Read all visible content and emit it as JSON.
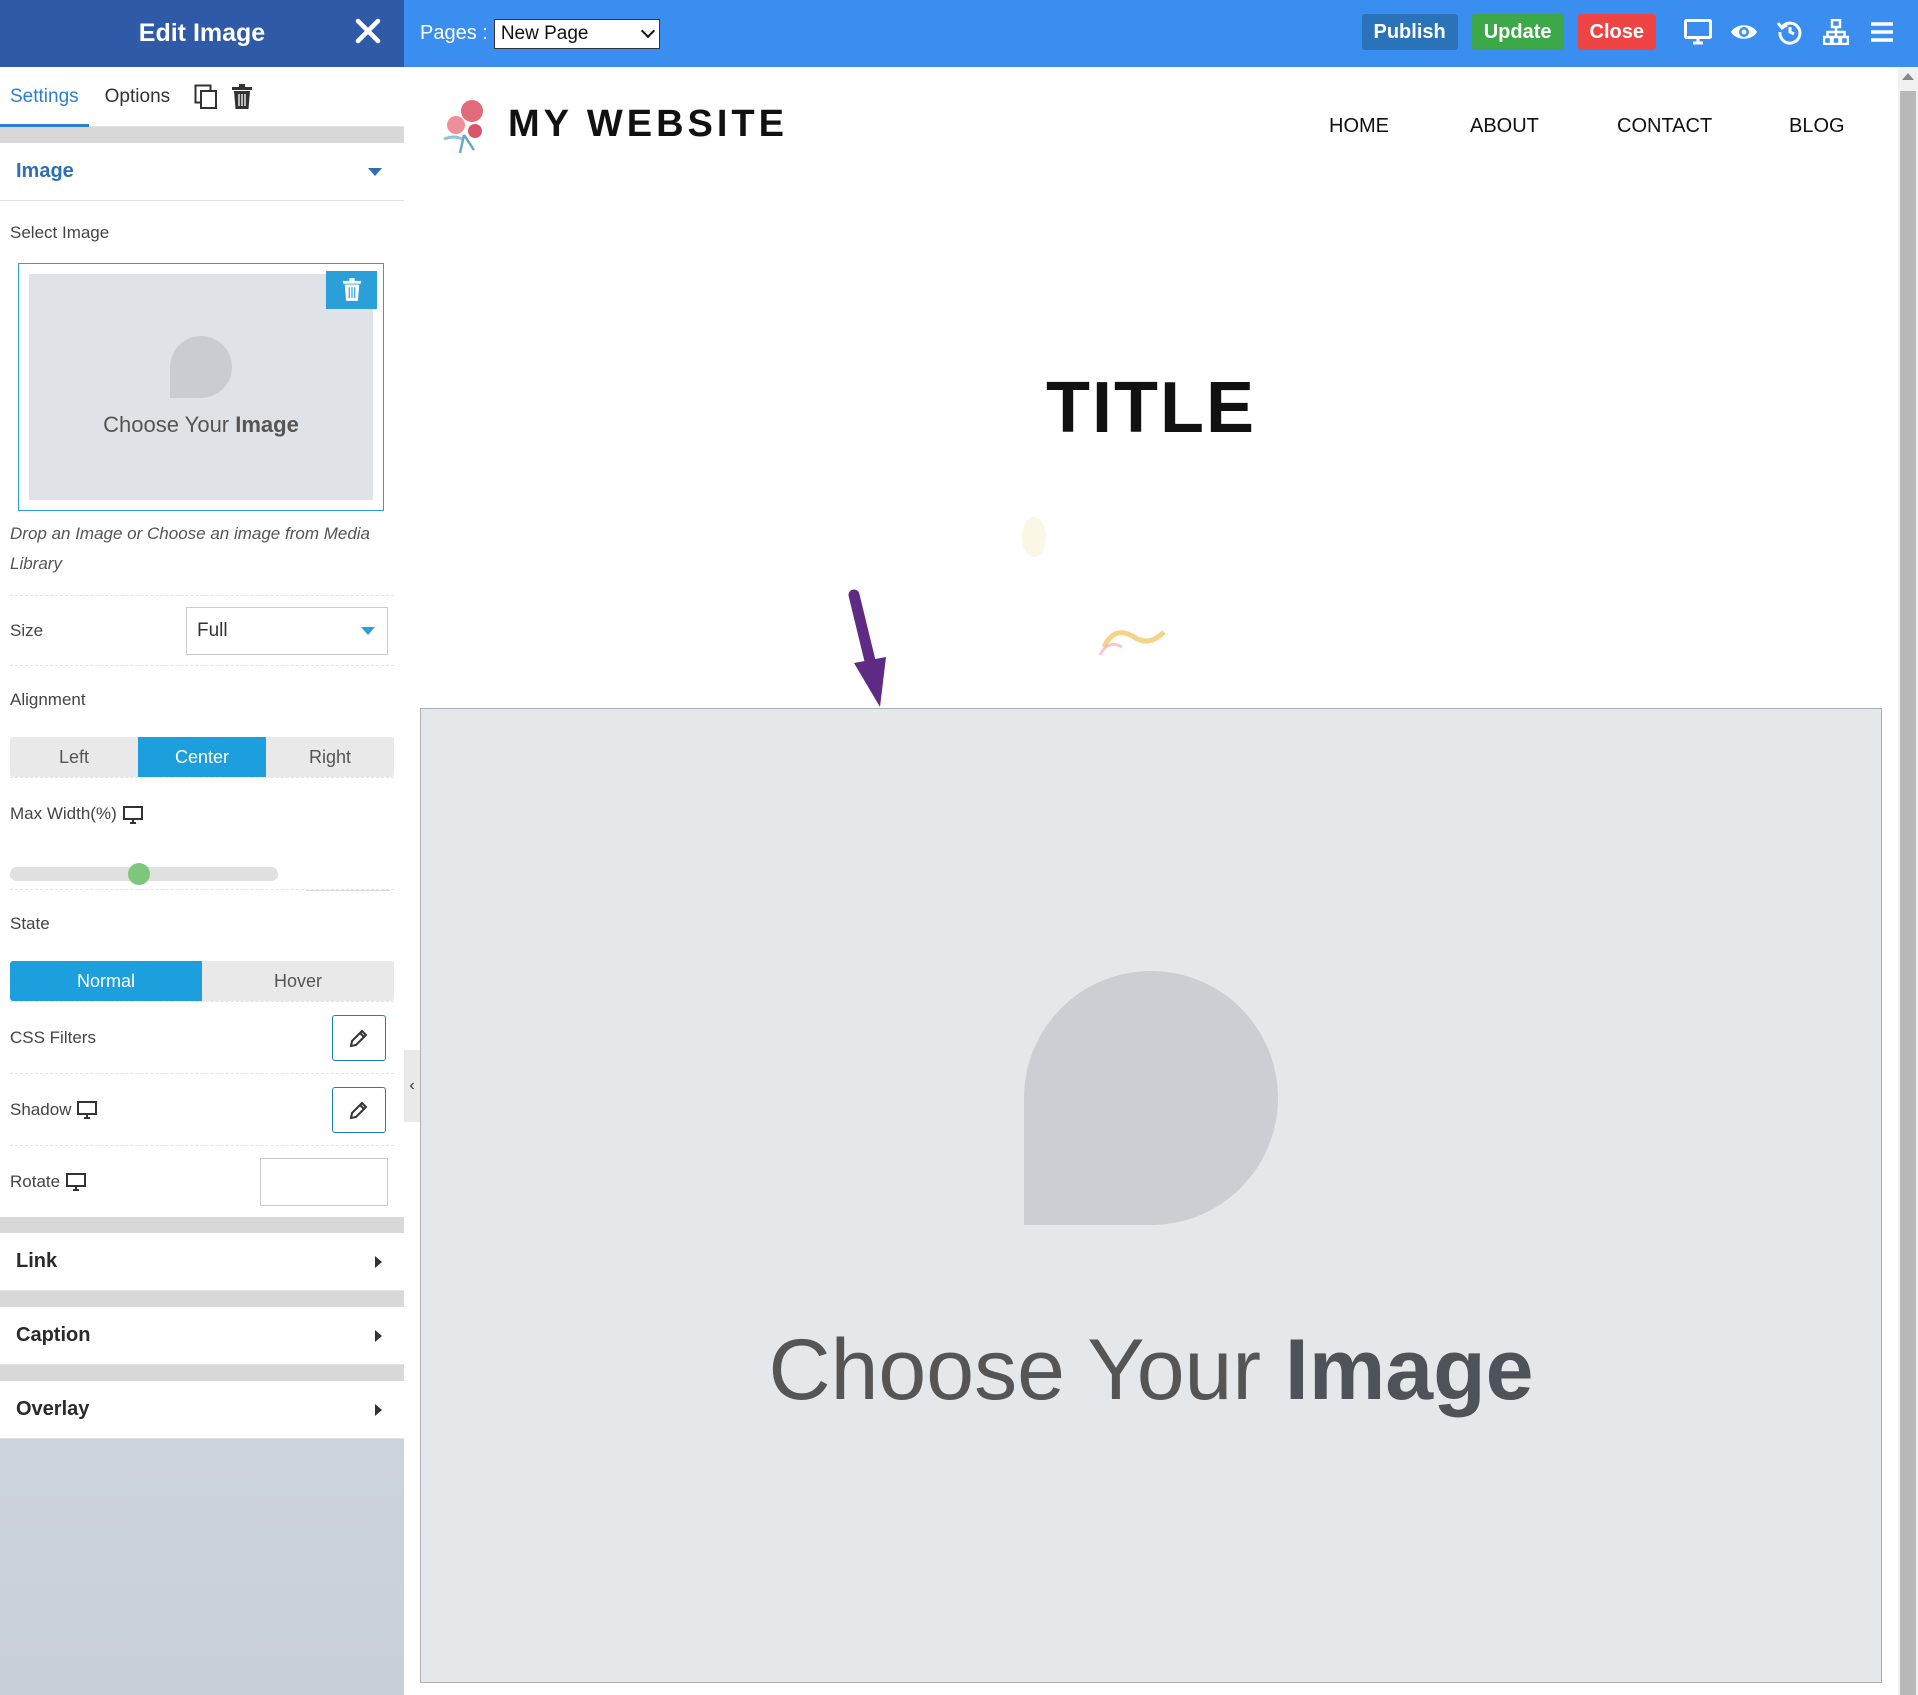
{
  "panel": {
    "title": "Edit Image",
    "tabs": {
      "settings": "Settings",
      "options": "Options"
    },
    "sections": {
      "image": {
        "title": "Image",
        "select_image_label": "Select Image",
        "picker_text_light": "Choose  Your ",
        "picker_text_bold": "Image",
        "drop_hint": "Drop an Image or Choose an image from Media Library",
        "size_label": "Size",
        "size_value": "Full",
        "alignment_label": "Alignment",
        "alignment_options": [
          "Left",
          "Center",
          "Right"
        ],
        "alignment_selected": "Center",
        "max_width_label": "Max Width(%)",
        "max_width_slider_fraction": 0.48,
        "state_label": "State",
        "state_options": [
          "Normal",
          "Hover"
        ],
        "state_selected": "Normal",
        "css_filters_label": "CSS Filters",
        "shadow_label": "Shadow",
        "rotate_label": "Rotate"
      },
      "link": {
        "title": "Link"
      },
      "caption": {
        "title": "Caption"
      },
      "overlay": {
        "title": "Overlay"
      }
    }
  },
  "topbar": {
    "pages_label": "Pages :",
    "pages_selected": "New Page",
    "publish_label": "Publish",
    "update_label": "Update",
    "close_label": "Close",
    "icons": [
      "monitor-icon",
      "eye-icon",
      "history-icon",
      "sitemap-icon",
      "menu-icon"
    ]
  },
  "site": {
    "name": "MY WEBSITE",
    "nav": [
      "HOME",
      "ABOUT",
      "CONTACT",
      "BLOG"
    ],
    "title": "TITLE",
    "placeholder_text_light": "Choose  Your ",
    "placeholder_text_bold": "Image"
  },
  "colors": {
    "panel_header": "#2e5aa8",
    "topbar": "#3a8ef0",
    "accent": "#1d9fde",
    "publish": "#2a73b8",
    "update": "#3da847",
    "close": "#ef4444",
    "arrow": "#5e2a84"
  }
}
